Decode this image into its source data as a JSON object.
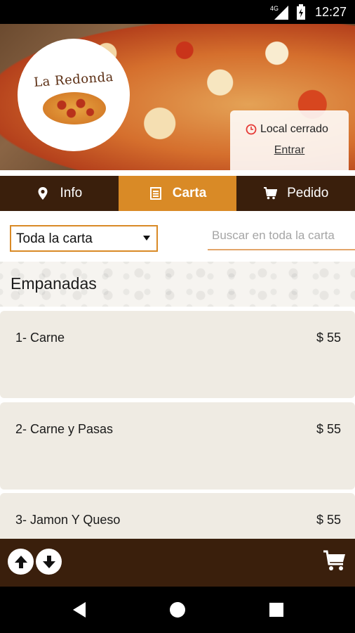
{
  "status_bar": {
    "time": "12:27",
    "network": "4G"
  },
  "restaurant": {
    "logo_text": "La Redonda",
    "status_text": "Local cerrado",
    "enter_link": "Entrar"
  },
  "tabs": [
    {
      "label": "Info",
      "icon": "location-pin-icon",
      "active": false
    },
    {
      "label": "Carta",
      "icon": "menu-list-icon",
      "active": true
    },
    {
      "label": "Pedido",
      "icon": "cart-icon",
      "active": false
    }
  ],
  "filter": {
    "selected": "Toda la carta",
    "search_placeholder": "Buscar en toda la carta"
  },
  "category": {
    "title": "Empanadas"
  },
  "items": [
    {
      "name": "1- Carne",
      "price": "$ 55"
    },
    {
      "name": "2- Carne y Pasas",
      "price": "$ 55"
    },
    {
      "name": "3- Jamon Y Queso",
      "price": "$ 55"
    }
  ],
  "colors": {
    "brown_dark": "#3a1f0c",
    "accent_orange": "#d98a26",
    "item_bg": "#efebe3",
    "closed_red": "#e53935"
  },
  "bottom_bar": {
    "icons": [
      "arrow-up-icon",
      "arrow-down-icon",
      "cart-icon"
    ]
  },
  "nav_bar": {
    "icons": [
      "back-icon",
      "home-icon",
      "recents-icon"
    ]
  }
}
